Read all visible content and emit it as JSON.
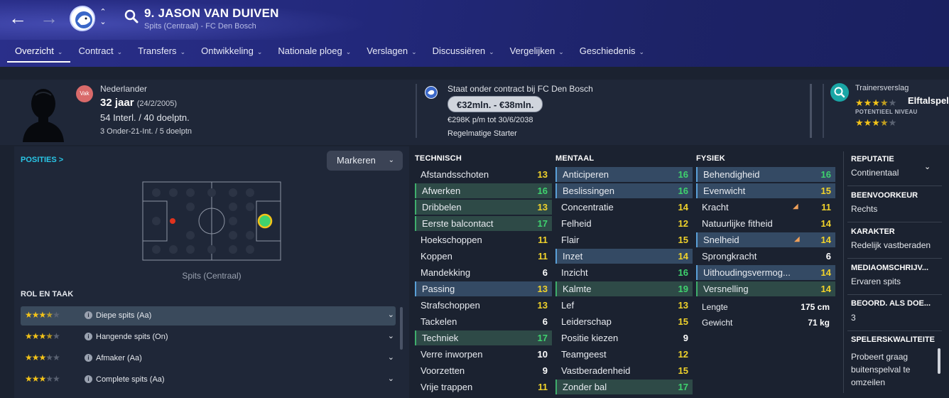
{
  "header": {
    "player_title": "9. JASON VAN DUIVEN",
    "subtitle": "Spits (Centraal) - FC Den Bosch",
    "back_icon": "arrow-left-icon",
    "forward_icon": "arrow-right-icon",
    "tabs": [
      {
        "label": "Overzicht",
        "active": true
      },
      {
        "label": "Contract"
      },
      {
        "label": "Transfers"
      },
      {
        "label": "Ontwikkeling"
      },
      {
        "label": "Nationale ploeg"
      },
      {
        "label": "Verslagen"
      },
      {
        "label": "Discussiëren"
      },
      {
        "label": "Vergelijken"
      },
      {
        "label": "Geschiedenis"
      }
    ]
  },
  "info": {
    "badge": "Vak",
    "nationality": "Nederlander",
    "age": "32 jaar",
    "dob": "(24/2/2005)",
    "caps": "54 Interl. / 40 doelptn.",
    "u21": "3 Onder-21-Int. / 5 doelptn",
    "contract_title": "Staat onder contract bij FC Den Bosch",
    "value_range": "€32mln. - €38mln.",
    "wage": "€298K p/m tot 30/6/2038",
    "squad_status": "Regelmatige Starter",
    "scout_title": "Trainersverslag",
    "scout_level": "Elftalspel",
    "potential_label": "POTENTIEEL NIVEAU",
    "current_stars": 3.5,
    "potential_stars": 3.5
  },
  "positions": {
    "link": "POSITIES >",
    "mark_button": "Markeren",
    "position_label": "Spits (Centraal)",
    "role_heading": "ROL EN TAAK",
    "roles": [
      {
        "label": "Diepe spits (Aa)",
        "stars": 3.5
      },
      {
        "label": "Hangende spits (On)",
        "stars": 3.5
      },
      {
        "label": "Afmaker (Aa)",
        "stars": 3
      },
      {
        "label": "Complete spits (Aa)",
        "stars": 3
      }
    ]
  },
  "attributes": {
    "technical_heading": "TECHNISCH",
    "mental_heading": "MENTAAL",
    "physical_heading": "FYSIEK",
    "technical": [
      {
        "name": "Afstandsschoten",
        "value": "13"
      },
      {
        "name": "Afwerken",
        "value": "16"
      },
      {
        "name": "Dribbelen",
        "value": "13"
      },
      {
        "name": "Eerste balcontact",
        "value": "17"
      },
      {
        "name": "Hoekschoppen",
        "value": "11"
      },
      {
        "name": "Koppen",
        "value": "11"
      },
      {
        "name": "Mandekking",
        "value": "6"
      },
      {
        "name": "Passing",
        "value": "13"
      },
      {
        "name": "Strafschoppen",
        "value": "13"
      },
      {
        "name": "Tackelen",
        "value": "6"
      },
      {
        "name": "Techniek",
        "value": "17"
      },
      {
        "name": "Verre inworpen",
        "value": "10"
      },
      {
        "name": "Voorzetten",
        "value": "9"
      },
      {
        "name": "Vrije trappen",
        "value": "11"
      }
    ],
    "mental": [
      {
        "name": "Anticiperen",
        "value": "16"
      },
      {
        "name": "Beslissingen",
        "value": "16"
      },
      {
        "name": "Concentratie",
        "value": "14"
      },
      {
        "name": "Felheid",
        "value": "12"
      },
      {
        "name": "Flair",
        "value": "15"
      },
      {
        "name": "Inzet",
        "value": "14"
      },
      {
        "name": "Inzicht",
        "value": "16"
      },
      {
        "name": "Kalmte",
        "value": "19"
      },
      {
        "name": "Lef",
        "value": "13"
      },
      {
        "name": "Leiderschap",
        "value": "15"
      },
      {
        "name": "Positie kiezen",
        "value": "9"
      },
      {
        "name": "Teamgeest",
        "value": "12"
      },
      {
        "name": "Vastberadenheid",
        "value": "15"
      },
      {
        "name": "Zonder bal",
        "value": "17"
      }
    ],
    "physical": [
      {
        "name": "Behendigheid",
        "value": "16"
      },
      {
        "name": "Evenwicht",
        "value": "15"
      },
      {
        "name": "Kracht",
        "value": "11"
      },
      {
        "name": "Natuurlijke fitheid",
        "value": "14"
      },
      {
        "name": "Snelheid",
        "value": "14"
      },
      {
        "name": "Sprongkracht",
        "value": "6"
      },
      {
        "name": "Uithoudingsvermog...",
        "value": "14"
      },
      {
        "name": "Versnelling",
        "value": "14"
      }
    ],
    "length_label": "Lengte",
    "length_value": "175 cm",
    "weight_label": "Gewicht",
    "weight_value": "71 kg"
  },
  "sidebar": {
    "reputation_label": "REPUTATIE",
    "reputation_value": "Continentaal",
    "foot_label": "BEENVOORKEUR",
    "foot_value": "Rechts",
    "character_label": "KARAKTER",
    "character_value": "Redelijk vastberaden",
    "media_label": "MEDIAOMSCHRIJV...",
    "media_value": "Ervaren spits",
    "rating_label": "BEOORD. ALS DOE...",
    "rating_value": "3",
    "traits_label": "SPELERSKWALITEITE",
    "traits_line1": "Probeert graag",
    "traits_line2": "buitenspelval te",
    "traits_line3": "omzeilen"
  },
  "colors": {
    "accent": "#29c6e6",
    "green_value": "#3fd26e",
    "yellow_value": "#f0d22b",
    "star": "#f3c319"
  }
}
